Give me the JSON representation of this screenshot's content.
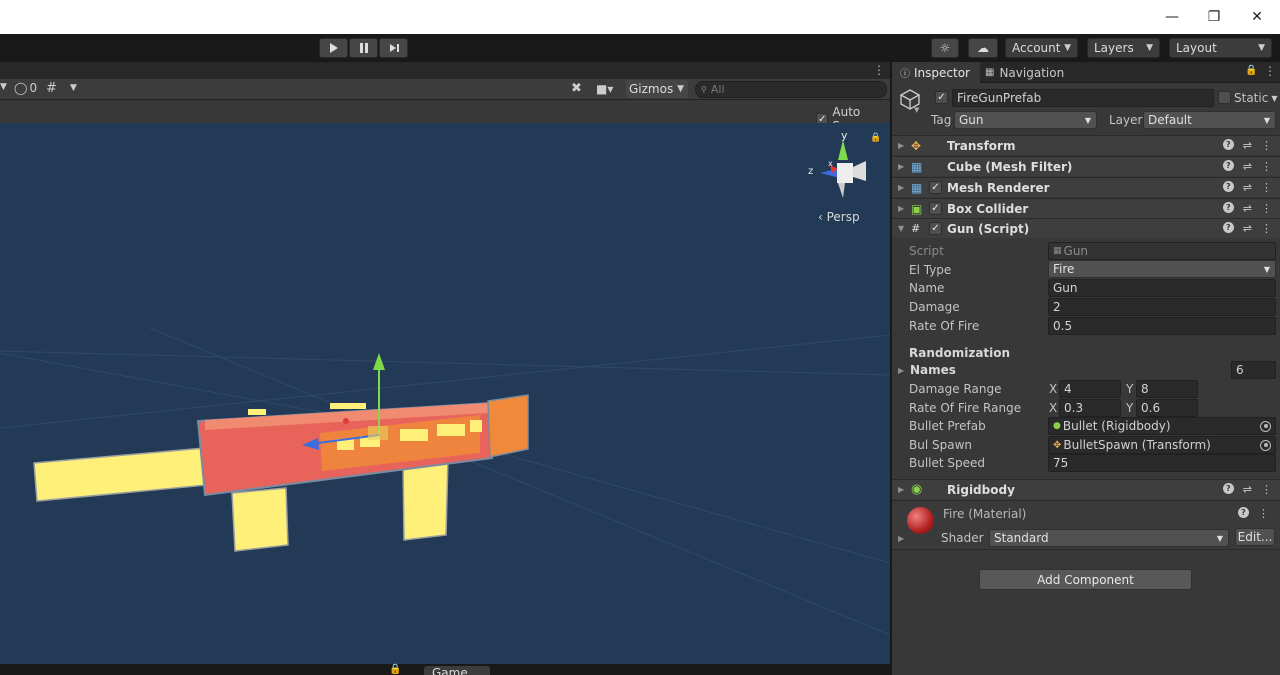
{
  "toolbar": {
    "account_label": "Account",
    "layers_label": "Layers",
    "layout_label": "Layout"
  },
  "scene": {
    "visibility_count": "0",
    "gizmos_label": "Gizmos",
    "search_placeholder": "All",
    "auto_save_label": "Auto Save",
    "persp_label": "‹ Persp",
    "axis_y": "y",
    "axis_z": "z",
    "axis_x": "x",
    "bottom_tab_label": "Game"
  },
  "inspector": {
    "tab_inspector": "Inspector",
    "tab_navigation": "Navigation",
    "object_name": "FireGunPrefab",
    "static_label": "Static",
    "tag_label": "Tag",
    "tag_value": "Gun",
    "layer_label": "Layer",
    "layer_value": "Default",
    "components": [
      {
        "name": "Transform"
      },
      {
        "name": "Cube (Mesh Filter)"
      },
      {
        "name": "Mesh Renderer"
      },
      {
        "name": "Box Collider"
      },
      {
        "name": "Gun (Script)"
      },
      {
        "name": "Rigidbody"
      }
    ],
    "gun_script": {
      "script_label": "Script",
      "script_value": "Gun",
      "el_type_label": "El Type",
      "el_type_value": "Fire",
      "name_label": "Name",
      "name_value": "Gun",
      "damage_label": "Damage",
      "damage_value": "2",
      "rate_of_fire_label": "Rate Of Fire",
      "rate_of_fire_value": "0.5",
      "randomization_header": "Randomization",
      "names_label": "Names",
      "names_count": "6",
      "damage_range_label": "Damage Range",
      "damage_range_x": "4",
      "damage_range_y": "8",
      "rate_range_label": "Rate Of Fire Range",
      "rate_range_x": "0.3",
      "rate_range_y": "0.6",
      "bullet_prefab_label": "Bullet Prefab",
      "bullet_prefab_value": "Bullet (Rigidbody)",
      "bul_spawn_label": "Bul Spawn",
      "bul_spawn_value": "BulletSpawn (Transform)",
      "bullet_speed_label": "Bullet Speed",
      "bullet_speed_value": "75",
      "x_label": "X",
      "y_label": "Y"
    },
    "material": {
      "name": "Fire (Material)",
      "shader_label": "Shader",
      "shader_value": "Standard",
      "edit_label": "Edit..."
    },
    "add_component_label": "Add Component"
  },
  "colors": {
    "viewport_bg": "#223a55",
    "panel_bg": "#383838",
    "gun_body": "#e8645a",
    "gun_barrel": "#fff07a",
    "gun_accent": "#f0893a"
  }
}
